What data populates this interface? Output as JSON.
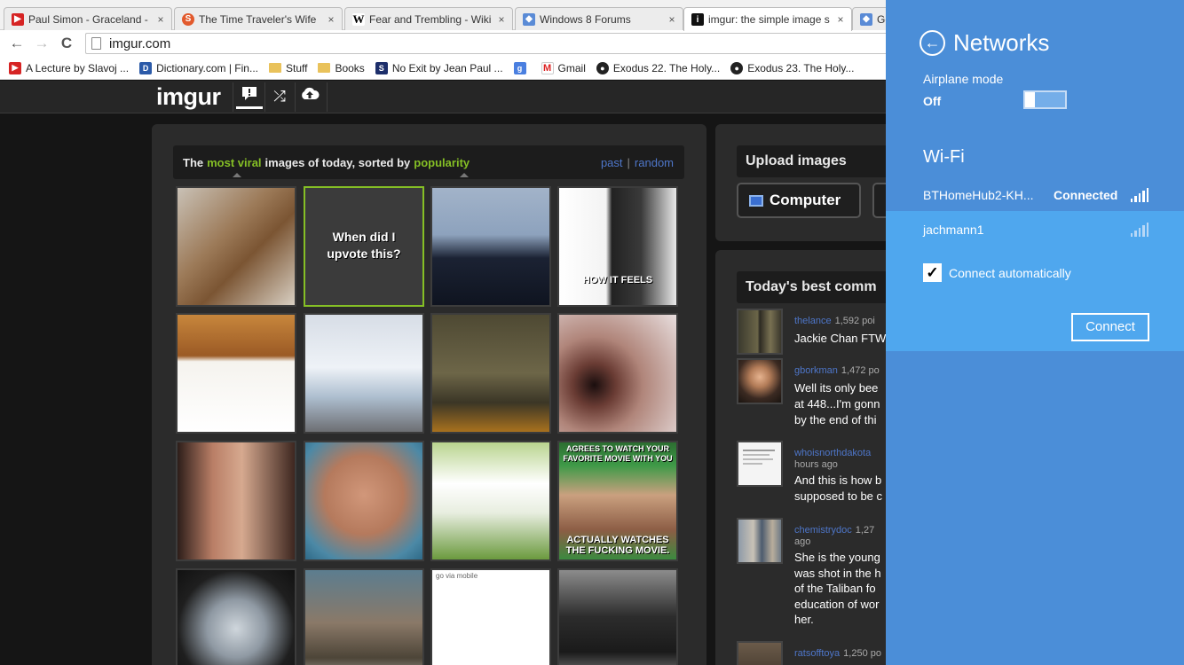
{
  "browser": {
    "tabs": [
      {
        "label": "Paul Simon - Graceland - ",
        "close": "×",
        "favicon": "youtube-icon",
        "color": "#d62424"
      },
      {
        "label": "The Time Traveler's Wife",
        "close": "×",
        "favicon": "stumbleupon-icon",
        "color": "#e25a2d"
      },
      {
        "label": "Fear and Trembling - Wiki",
        "close": "×",
        "favicon": "wikipedia-icon",
        "color": "#ffffff"
      },
      {
        "label": "Windows 8 Forums",
        "close": "×",
        "favicon": "windows8forums-icon",
        "color": "#5a8bd6"
      },
      {
        "label": "imgur: the simple image s",
        "close": "×",
        "favicon": "imgur-icon",
        "color": "#111111"
      },
      {
        "label": "Ge",
        "close": "",
        "favicon": "windows8forums-icon",
        "color": "#5a8bd6"
      }
    ],
    "nav": {
      "back": "←",
      "forward": "→",
      "reload": "C"
    },
    "url": "imgur.com",
    "bookmarks": [
      {
        "label": "A Lecture by Slavoj ...",
        "icon": "youtube-icon"
      },
      {
        "label": "Dictionary.com | Fin...",
        "icon": "dictionary-icon"
      },
      {
        "label": "Stuff",
        "icon": "folder-icon"
      },
      {
        "label": "Books",
        "icon": "folder-icon"
      },
      {
        "label": "No Exit by Jean Paul ...",
        "icon": "bookmark-site-icon"
      },
      {
        "label": "",
        "icon": "google-icon"
      },
      {
        "label": "Gmail",
        "icon": "gmail-icon"
      },
      {
        "label": "Exodus 22. The Holy...",
        "icon": "globe-icon"
      },
      {
        "label": "Exodus 23. The Holy...",
        "icon": "globe-icon"
      }
    ]
  },
  "imgur": {
    "logo": "imgur",
    "gallery": {
      "intro1": "The",
      "hl1": "most viral",
      "intro2": "images of today, sorted by",
      "hl2": "popularity",
      "past": "past",
      "pipe": "|",
      "random": "random",
      "thumbs": [
        {
          "name": "thumb-boots",
          "text": ""
        },
        {
          "name": "thumb-upvote-meme",
          "text": "When did I upvote this?"
        },
        {
          "name": "thumb-boy-pipe",
          "text": ""
        },
        {
          "name": "thumb-computer-case",
          "text": "HOW IT FEELS"
        },
        {
          "name": "thumb-drawing-toy",
          "text": ""
        },
        {
          "name": "thumb-frozen-tree",
          "text": ""
        },
        {
          "name": "thumb-old-photo",
          "text": ""
        },
        {
          "name": "thumb-monkey",
          "text": ""
        },
        {
          "name": "thumb-tattoo",
          "text": ""
        },
        {
          "name": "thumb-elephant-seal",
          "text": ""
        },
        {
          "name": "thumb-dogs",
          "text": ""
        },
        {
          "name": "thumb-good-guy-greg",
          "text": "AGREES TO WATCH YOUR FAVORITE MOVIE WITH YOU",
          "text2": "ACTUALLY WATCHES THE FUCKING MOVIE."
        },
        {
          "name": "thumb-stingray",
          "text": ""
        },
        {
          "name": "thumb-dinosaur",
          "text": ""
        },
        {
          "name": "thumb-journal-text",
          "text": "go via mobile"
        },
        {
          "name": "thumb-cat-bee",
          "text": ""
        }
      ]
    },
    "upload": {
      "title": "Upload images",
      "computer": "Computer"
    },
    "comments": {
      "title": "Today's best comm",
      "items": [
        {
          "user": "thelance",
          "meta": "1,592 poi",
          "lines": [
            "Jackie Chan FTW"
          ]
        },
        {
          "user": "gborkman",
          "meta": "1,472 po",
          "lines": [
            "Well its only bee",
            "at 448...I'm gonn",
            "by the end of thi"
          ]
        },
        {
          "user": "whoisnorthdakota",
          "meta": "hours ago",
          "lines": [
            "And this is how b",
            "supposed to be c"
          ]
        },
        {
          "user": "chemistrydoc",
          "meta": "1,27",
          "meta2": "ago",
          "lines": [
            "She is the young",
            "was shot in the h",
            "of the Taliban fo",
            "education of wor",
            "her."
          ]
        },
        {
          "user": "ratsofftoya",
          "meta": "1,250 po",
          "lines": []
        }
      ]
    }
  },
  "charm": {
    "title": "Networks",
    "airplane_label": "Airplane mode",
    "airplane_state": "Off",
    "wifi_label": "Wi-Fi",
    "networks": [
      {
        "name": "BTHomeHub2-KH...",
        "status": "Connected"
      },
      {
        "name": "jachmann1",
        "status": ""
      }
    ],
    "auto_label": "Connect automatically",
    "connect_label": "Connect",
    "colors": {
      "bg": "#4b8ed8",
      "selected": "#4fa7ee"
    }
  }
}
